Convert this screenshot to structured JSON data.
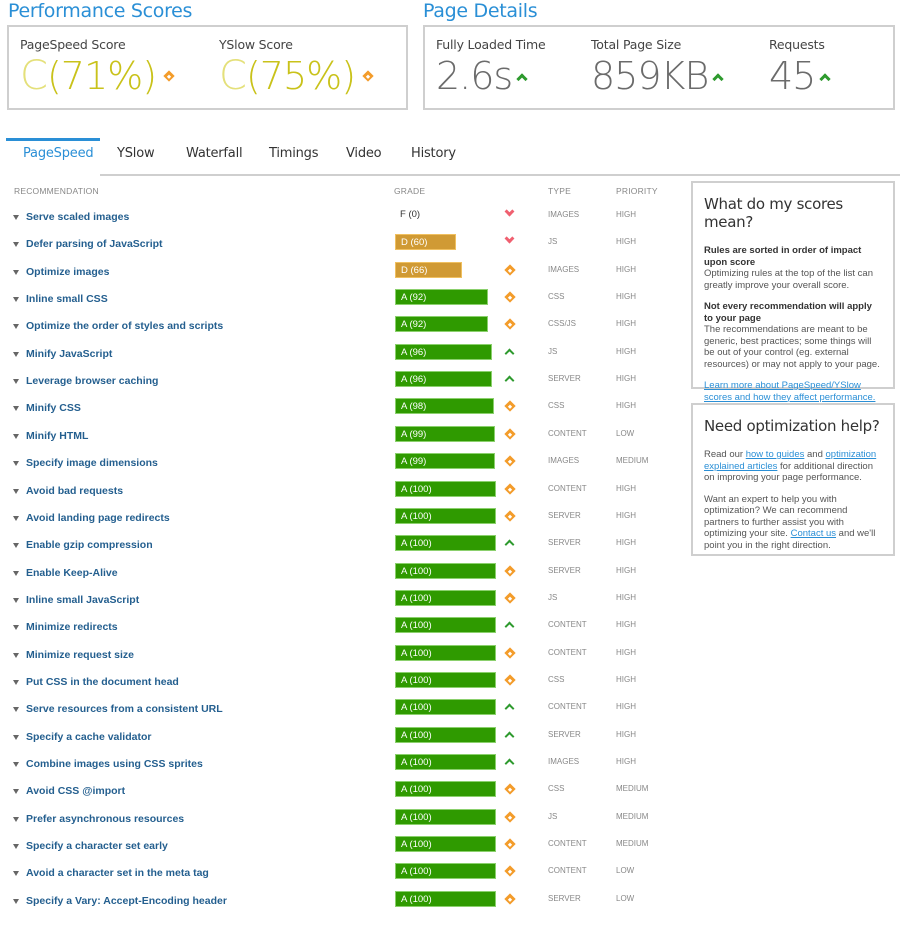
{
  "performance": {
    "title": "Performance Scores",
    "pagespeed": {
      "label": "PageSpeed Score",
      "letter": "C",
      "percent": "(71%)",
      "trend": "diamond-icon"
    },
    "yslow": {
      "label": "YSlow Score",
      "letter": "C",
      "percent": "(75%)",
      "trend": "diamond-icon"
    }
  },
  "details": {
    "title": "Page Details",
    "items": [
      {
        "label": "Fully Loaded Time",
        "value": "2.6s",
        "trend": "caret-up-icon"
      },
      {
        "label": "Total Page Size",
        "value": "859KB",
        "trend": "caret-up-icon"
      },
      {
        "label": "Requests",
        "value": "45",
        "trend": "caret-up-icon"
      }
    ]
  },
  "tabs": [
    {
      "label": "PageSpeed",
      "active": true
    },
    {
      "label": "YSlow",
      "active": false
    },
    {
      "label": "Waterfall",
      "active": false
    },
    {
      "label": "Timings",
      "active": false
    },
    {
      "label": "Video",
      "active": false
    },
    {
      "label": "History",
      "active": false
    }
  ],
  "table": {
    "headers": {
      "recommendation": "RECOMMENDATION",
      "grade": "GRADE",
      "type": "TYPE",
      "priority": "PRIORITY"
    },
    "rows": [
      {
        "rec": "Serve scaled images",
        "grade": "F (0)",
        "score": 0,
        "trend": "down",
        "type": "IMAGES",
        "priority": "HIGH"
      },
      {
        "rec": "Defer parsing of JavaScript",
        "grade": "D (60)",
        "score": 60,
        "trend": "down",
        "type": "JS",
        "priority": "HIGH"
      },
      {
        "rec": "Optimize images",
        "grade": "D (66)",
        "score": 66,
        "trend": "diamond",
        "type": "IMAGES",
        "priority": "HIGH"
      },
      {
        "rec": "Inline small CSS",
        "grade": "A (92)",
        "score": 92,
        "trend": "diamond",
        "type": "CSS",
        "priority": "HIGH"
      },
      {
        "rec": "Optimize the order of styles and scripts",
        "grade": "A (92)",
        "score": 92,
        "trend": "diamond",
        "type": "CSS/JS",
        "priority": "HIGH"
      },
      {
        "rec": "Minify JavaScript",
        "grade": "A (96)",
        "score": 96,
        "trend": "up",
        "type": "JS",
        "priority": "HIGH"
      },
      {
        "rec": "Leverage browser caching",
        "grade": "A (96)",
        "score": 96,
        "trend": "up",
        "type": "SERVER",
        "priority": "HIGH"
      },
      {
        "rec": "Minify CSS",
        "grade": "A (98)",
        "score": 98,
        "trend": "diamond",
        "type": "CSS",
        "priority": "HIGH"
      },
      {
        "rec": "Minify HTML",
        "grade": "A (99)",
        "score": 99,
        "trend": "diamond",
        "type": "CONTENT",
        "priority": "LOW"
      },
      {
        "rec": "Specify image dimensions",
        "grade": "A (99)",
        "score": 99,
        "trend": "diamond",
        "type": "IMAGES",
        "priority": "MEDIUM"
      },
      {
        "rec": "Avoid bad requests",
        "grade": "A (100)",
        "score": 100,
        "trend": "diamond",
        "type": "CONTENT",
        "priority": "HIGH"
      },
      {
        "rec": "Avoid landing page redirects",
        "grade": "A (100)",
        "score": 100,
        "trend": "diamond",
        "type": "SERVER",
        "priority": "HIGH"
      },
      {
        "rec": "Enable gzip compression",
        "grade": "A (100)",
        "score": 100,
        "trend": "up",
        "type": "SERVER",
        "priority": "HIGH"
      },
      {
        "rec": "Enable Keep-Alive",
        "grade": "A (100)",
        "score": 100,
        "trend": "diamond",
        "type": "SERVER",
        "priority": "HIGH"
      },
      {
        "rec": "Inline small JavaScript",
        "grade": "A (100)",
        "score": 100,
        "trend": "diamond",
        "type": "JS",
        "priority": "HIGH"
      },
      {
        "rec": "Minimize redirects",
        "grade": "A (100)",
        "score": 100,
        "trend": "up",
        "type": "CONTENT",
        "priority": "HIGH"
      },
      {
        "rec": "Minimize request size",
        "grade": "A (100)",
        "score": 100,
        "trend": "diamond",
        "type": "CONTENT",
        "priority": "HIGH"
      },
      {
        "rec": "Put CSS in the document head",
        "grade": "A (100)",
        "score": 100,
        "trend": "diamond",
        "type": "CSS",
        "priority": "HIGH"
      },
      {
        "rec": "Serve resources from a consistent URL",
        "grade": "A (100)",
        "score": 100,
        "trend": "up",
        "type": "CONTENT",
        "priority": "HIGH"
      },
      {
        "rec": "Specify a cache validator",
        "grade": "A (100)",
        "score": 100,
        "trend": "up",
        "type": "SERVER",
        "priority": "HIGH"
      },
      {
        "rec": "Combine images using CSS sprites",
        "grade": "A (100)",
        "score": 100,
        "trend": "up",
        "type": "IMAGES",
        "priority": "HIGH"
      },
      {
        "rec": "Avoid CSS @import",
        "grade": "A (100)",
        "score": 100,
        "trend": "diamond",
        "type": "CSS",
        "priority": "MEDIUM"
      },
      {
        "rec": "Prefer asynchronous resources",
        "grade": "A (100)",
        "score": 100,
        "trend": "diamond",
        "type": "JS",
        "priority": "MEDIUM"
      },
      {
        "rec": "Specify a character set early",
        "grade": "A (100)",
        "score": 100,
        "trend": "diamond",
        "type": "CONTENT",
        "priority": "MEDIUM"
      },
      {
        "rec": "Avoid a character set in the meta tag",
        "grade": "A (100)",
        "score": 100,
        "trend": "diamond",
        "type": "CONTENT",
        "priority": "LOW"
      },
      {
        "rec": "Specify a Vary: Accept-Encoding header",
        "grade": "A (100)",
        "score": 100,
        "trend": "diamond",
        "type": "SERVER",
        "priority": "LOW"
      }
    ]
  },
  "scores_box": {
    "title": "What do my scores mean?",
    "p1_bold": "Rules are sorted in order of impact upon score",
    "p1_text": "Optimizing rules at the top of the list can greatly improve your overall score.",
    "p2_bold": "Not every recommendation will apply to your page",
    "p2_text": "The recommendations are meant to be generic, best practices; some things will be out of your control (eg. external resources) or may not apply to your page.",
    "link": "Learn more about PageSpeed/YSlow scores and how they affect performance."
  },
  "help_box": {
    "title": "Need optimization help?",
    "p1_a": "Read our ",
    "p1_link1": "how to guides",
    "p1_b": " and ",
    "p1_link2": "optimization explained articles",
    "p1_c": " for additional direction on improving your page performance.",
    "p2_a": "Want an expert to help you with optimization? We can recommend partners to further assist you with optimizing your site. ",
    "p2_link": "Contact us",
    "p2_b": " and we'll point you in the right direction."
  },
  "colors": {
    "accent": "#2a8fd6",
    "grade_a": "#2f9a00",
    "grade_d": "#d09a34",
    "trend_up": "#2e9a2e",
    "trend_down": "#f06070",
    "trend_neutral": "#f39c2a",
    "score_c": "#c9c21a"
  }
}
